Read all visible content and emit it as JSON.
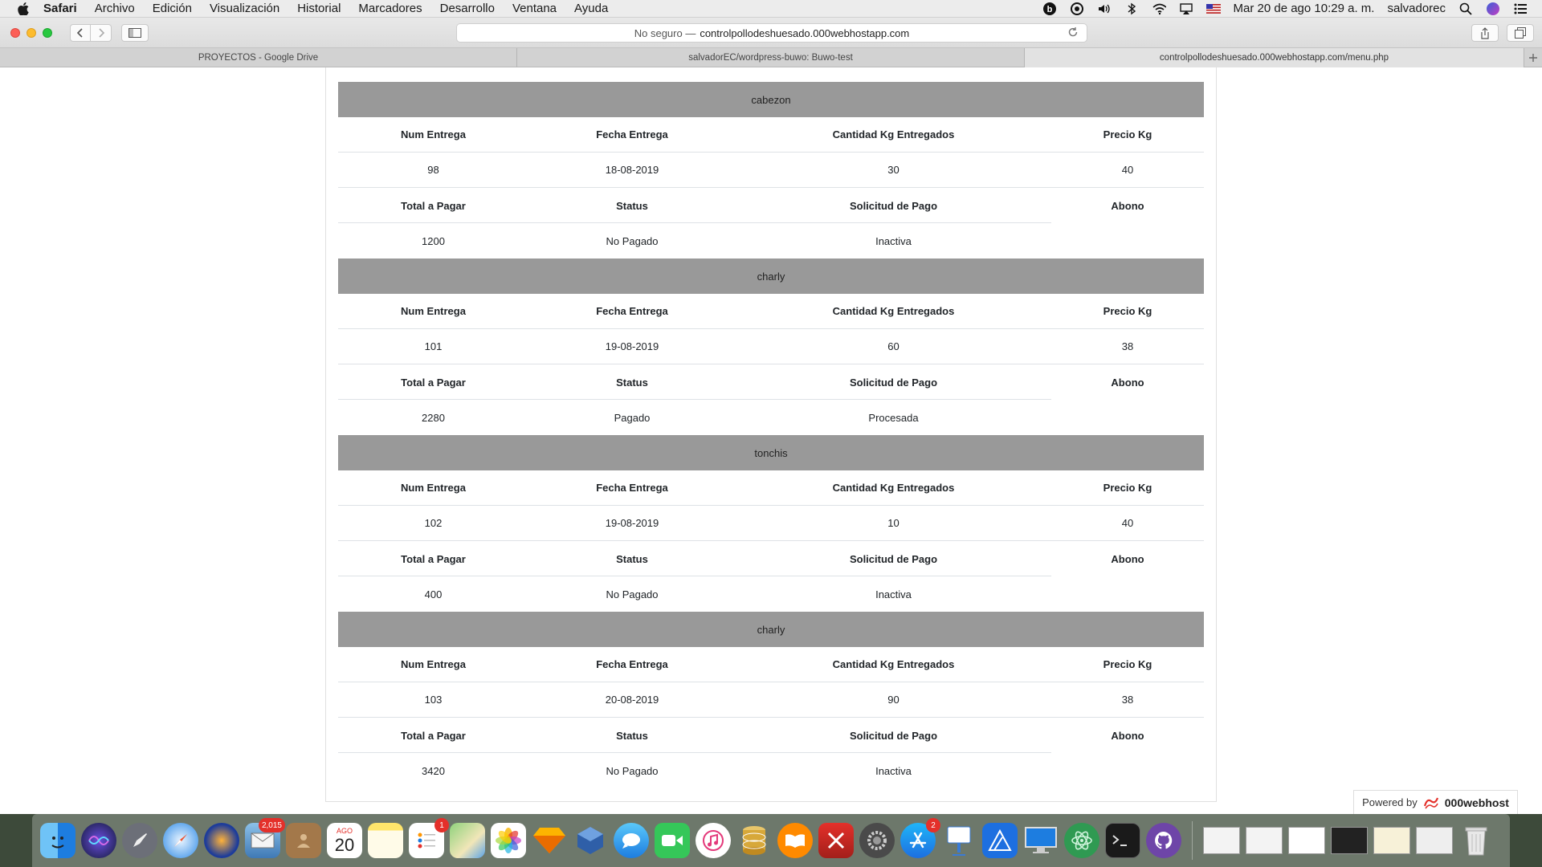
{
  "menubar": {
    "app": "Safari",
    "items": [
      "Archivo",
      "Edición",
      "Visualización",
      "Historial",
      "Marcadores",
      "Desarrollo",
      "Ventana",
      "Ayuda"
    ],
    "clock": "Mar 20 de ago  10:29 a. m.",
    "user": "salvadorec"
  },
  "toolbar": {
    "address_prefix": "No seguro —",
    "address_host": "controlpollodeshuesado.000webhostapp.com"
  },
  "tabs": [
    {
      "label": "PROYECTOS - Google Drive"
    },
    {
      "label": "salvadorEC/wordpress-buwo: Buwo-test"
    },
    {
      "label": "controlpollodeshuesado.000webhostapp.com/menu.php"
    }
  ],
  "labels": {
    "num_entrega": "Num Entrega",
    "fecha_entrega": "Fecha Entrega",
    "cantidad_kg": "Cantidad Kg Entregados",
    "precio_kg": "Precio Kg",
    "total_pagar": "Total a Pagar",
    "status": "Status",
    "solicitud_pago": "Solicitud de Pago",
    "abono": "Abono"
  },
  "entries": [
    {
      "name": "cabezon",
      "num": "98",
      "fecha": "18-08-2019",
      "cantidad": "30",
      "precio": "40",
      "total": "1200",
      "status": "No Pagado",
      "solicitud": "Inactiva"
    },
    {
      "name": "charly",
      "num": "101",
      "fecha": "19-08-2019",
      "cantidad": "60",
      "precio": "38",
      "total": "2280",
      "status": "Pagado",
      "solicitud": "Procesada"
    },
    {
      "name": "tonchis",
      "num": "102",
      "fecha": "19-08-2019",
      "cantidad": "10",
      "precio": "40",
      "total": "400",
      "status": "No Pagado",
      "solicitud": "Inactiva"
    },
    {
      "name": "charly",
      "num": "103",
      "fecha": "20-08-2019",
      "cantidad": "90",
      "precio": "38",
      "total": "3420",
      "status": "No Pagado",
      "solicitud": "Inactiva"
    }
  ],
  "powered": {
    "prefix": "Powered by",
    "brand": "000webhost"
  },
  "dock": {
    "calendar_month": "AGO",
    "calendar_day": "20",
    "badges": {
      "mail": "2,015",
      "reminders": "1",
      "appstore": "2"
    }
  },
  "colors": {
    "entry_header": "#999999",
    "row_border": "#dee2e6"
  }
}
